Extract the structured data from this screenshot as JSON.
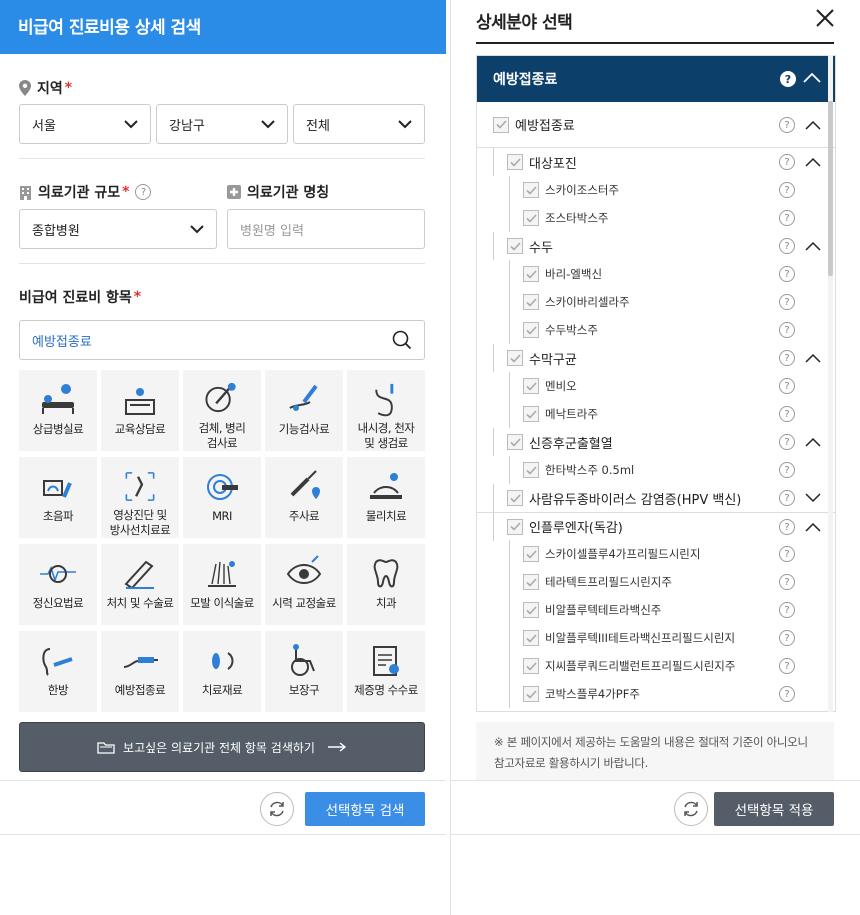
{
  "left": {
    "title": "비급여 진료비용 상세 검색",
    "region": {
      "label": "지역",
      "required": "*",
      "city": "서울",
      "district": "강남구",
      "dong": "전체"
    },
    "scale": {
      "label": "의료기관 규모",
      "required": "*",
      "help": "?",
      "value": "종합병원"
    },
    "name": {
      "label": "의료기관 명칭",
      "placeholder": "병원명 입력"
    },
    "items": {
      "label": "비급여 진료비 항목",
      "required": "*",
      "search_value": "예방접종료"
    },
    "categories": [
      {
        "label": "상급병실료",
        "icon": "hospital-bed-icon"
      },
      {
        "label": "교육상담료",
        "icon": "counseling-icon"
      },
      {
        "label": "검체, 병리\n검사료",
        "icon": "pathology-icon"
      },
      {
        "label": "기능검사료",
        "icon": "function-test-icon"
      },
      {
        "label": "내시경, 천자\n및 생검료",
        "icon": "endoscope-icon"
      },
      {
        "label": "초음파",
        "icon": "ultrasound-icon"
      },
      {
        "label": "영상진단 및\n방사선치료료",
        "icon": "radiology-icon"
      },
      {
        "label": "MRI",
        "icon": "mri-icon"
      },
      {
        "label": "주사료",
        "icon": "syringe-icon"
      },
      {
        "label": "물리치료",
        "icon": "physical-therapy-icon"
      },
      {
        "label": "정신요법료",
        "icon": "psychotherapy-icon"
      },
      {
        "label": "처치 및 수술료",
        "icon": "surgery-icon"
      },
      {
        "label": "모발 이식술료",
        "icon": "hair-transplant-icon"
      },
      {
        "label": "시력 교정술료",
        "icon": "eye-icon"
      },
      {
        "label": "치과",
        "icon": "tooth-icon"
      },
      {
        "label": "한방",
        "icon": "oriental-medicine-icon"
      },
      {
        "label": "예방접종료",
        "icon": "vaccine-icon"
      },
      {
        "label": "치료재료",
        "icon": "treatment-material-icon"
      },
      {
        "label": "보장구",
        "icon": "wheelchair-icon"
      },
      {
        "label": "제증명 수수료",
        "icon": "certificate-icon"
      }
    ],
    "all_search": "보고싶은 의료기관 전체 항목 검색하기",
    "search_selected": "선택항목 검색"
  },
  "right": {
    "title": "상세분야 선택",
    "header": "예방접종료",
    "root": "예방접종료",
    "tree": [
      {
        "level": 1,
        "label": "대상포진",
        "expand": "up"
      },
      {
        "level": 2,
        "label": "스카이조스터주"
      },
      {
        "level": 2,
        "label": "조스타박스주"
      },
      {
        "level": 1,
        "label": "수두",
        "expand": "up"
      },
      {
        "level": 2,
        "label": "바리-엘백신"
      },
      {
        "level": 2,
        "label": "스카이바리셀라주"
      },
      {
        "level": 2,
        "label": "수두박스주"
      },
      {
        "level": 1,
        "label": "수막구균",
        "expand": "up"
      },
      {
        "level": 2,
        "label": "멘비오"
      },
      {
        "level": 2,
        "label": "메낙트라주"
      },
      {
        "level": 1,
        "label": "신증후군출혈열",
        "expand": "up"
      },
      {
        "level": 2,
        "label": "한타박스주 0.5ml"
      },
      {
        "level": 1,
        "label": "사람유두종바이러스 감염증(HPV 백신)",
        "expand": "down"
      },
      {
        "level": 1,
        "label": "인플루엔자(독감)",
        "expand": "up"
      },
      {
        "level": 2,
        "label": "스카이셀플루4가프리필드시린지"
      },
      {
        "level": 2,
        "label": "테라텍트프리필드시린지주"
      },
      {
        "level": 2,
        "label": "비알플루텍테트라백신주"
      },
      {
        "level": 2,
        "label": "비알플루텍III테트라백신프리필드시린지"
      },
      {
        "level": 2,
        "label": "지씨플루쿼드리밸런트프리필드시린지주"
      },
      {
        "level": 2,
        "label": "코박스플루4가PF주"
      }
    ],
    "notice": "※ 본 페이지에서 제공하는 도움말의 내용은 절대적 기준이 아니오니참고자료로 활용하시기 바랍니다.",
    "apply": "선택항목 적용"
  },
  "colors": {
    "primary_blue": "#2b8ce8",
    "navy": "#0d3f6b",
    "dark_button": "#555d68",
    "required_red": "#e03030"
  }
}
